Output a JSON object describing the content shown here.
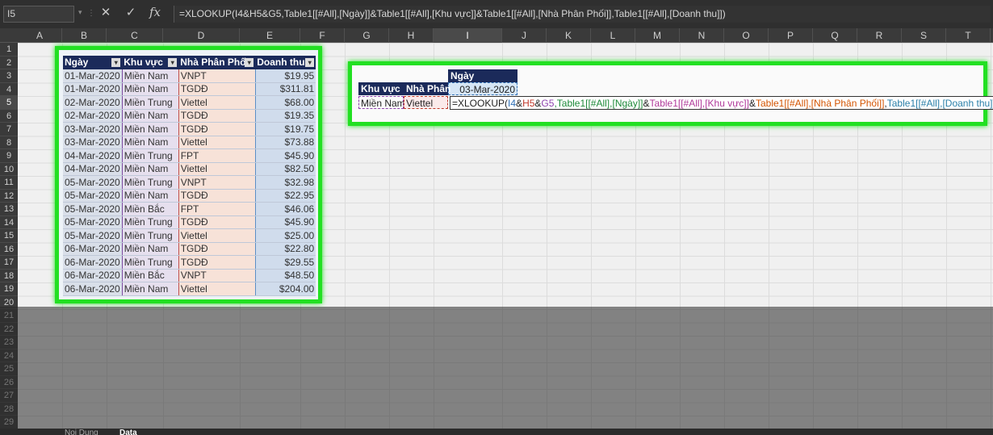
{
  "formula_bar": {
    "name_box": "I5",
    "cancel_icon": "close-icon",
    "enter_icon": "check-icon",
    "function_icon": "fx-icon",
    "formula": "=XLOOKUP(I4&H5&G5,Table1[[#All],[Ngày]]&Table1[[#All],[Khu vực]]&Table1[[#All],[Nhà Phân Phối]],Table1[[#All],[Doanh thu]])"
  },
  "columns": [
    "A",
    "B",
    "C",
    "D",
    "E",
    "F",
    "G",
    "H",
    "I",
    "J",
    "K",
    "L",
    "M",
    "N",
    "O",
    "P",
    "Q",
    "R",
    "S",
    "T"
  ],
  "rows": [
    "1",
    "2",
    "3",
    "4",
    "5",
    "6",
    "7",
    "8",
    "9",
    "10",
    "11",
    "12",
    "13",
    "14",
    "15",
    "16",
    "17",
    "18",
    "19",
    "20",
    "21",
    "22",
    "23",
    "24",
    "25",
    "26",
    "27",
    "28",
    "29"
  ],
  "table": {
    "headers": [
      "Ngày",
      "Khu vực",
      "Nhà Phân Phối",
      "Doanh thu"
    ],
    "rows": [
      [
        "01-Mar-2020",
        "Miền Nam",
        "VNPT",
        "$19.95"
      ],
      [
        "01-Mar-2020",
        "Miền Nam",
        "TGDĐ",
        "$311.81"
      ],
      [
        "02-Mar-2020",
        "Miền Trung",
        "Viettel",
        "$68.00"
      ],
      [
        "02-Mar-2020",
        "Miền Nam",
        "TGDĐ",
        "$19.35"
      ],
      [
        "03-Mar-2020",
        "Miền Nam",
        "TGDĐ",
        "$19.75"
      ],
      [
        "03-Mar-2020",
        "Miền Nam",
        "Viettel",
        "$73.88"
      ],
      [
        "04-Mar-2020",
        "Miền Trung",
        "FPT",
        "$45.90"
      ],
      [
        "04-Mar-2020",
        "Miền Nam",
        "Viettel",
        "$82.50"
      ],
      [
        "05-Mar-2020",
        "Miền Trung",
        "VNPT",
        "$32.98"
      ],
      [
        "05-Mar-2020",
        "Miền Nam",
        "TGDĐ",
        "$22.95"
      ],
      [
        "05-Mar-2020",
        "Miền Bắc",
        "FPT",
        "$46.06"
      ],
      [
        "05-Mar-2020",
        "Miền Trung",
        "TGDĐ",
        "$45.90"
      ],
      [
        "05-Mar-2020",
        "Miền Trung",
        "Viettel",
        "$25.00"
      ],
      [
        "06-Mar-2020",
        "Miền Nam",
        "TGDĐ",
        "$22.80"
      ],
      [
        "06-Mar-2020",
        "Miền Trung",
        "TGDĐ",
        "$29.55"
      ],
      [
        "06-Mar-2020",
        "Miền Bắc",
        "VNPT",
        "$48.50"
      ],
      [
        "06-Mar-2020",
        "Miền Nam",
        "Viettel",
        "$204.00"
      ]
    ]
  },
  "lookup": {
    "ngay_header": "Ngày",
    "ngay_value": "03-Mar-2020",
    "khuvuc_header": "Khu vực",
    "nhaphan_header": "Nhà Phân",
    "khuvuc_value": "Miền Nam",
    "nhaphan_value": "Viettel",
    "formula_parts": [
      {
        "text": "=XLOOKUP(",
        "color": "#222222"
      },
      {
        "text": "I4",
        "color": "#2f6fb5"
      },
      {
        "text": "&",
        "color": "#222222"
      },
      {
        "text": "H5",
        "color": "#c0392b"
      },
      {
        "text": "&",
        "color": "#222222"
      },
      {
        "text": "G5",
        "color": "#8e44ad"
      },
      {
        "text": ",Table1[[#All],[Ngày]]",
        "color": "#1e8a3a"
      },
      {
        "text": "&",
        "color": "#222222"
      },
      {
        "text": "Table1[[#All],[Khu vực]]",
        "color": "#b03a9a"
      },
      {
        "text": "&",
        "color": "#222222"
      },
      {
        "text": "Table1[[#All],[Nhà Phân Phối]]",
        "color": "#d35400"
      },
      {
        "text": ",",
        "color": "#222222"
      },
      {
        "text": "Table1[[#All],[Doanh thu]]",
        "color": "#2a7fa8"
      },
      {
        "text": ")",
        "color": "#222222"
      }
    ]
  },
  "sheet_tabs": [
    "Noi Dung",
    "Data"
  ]
}
